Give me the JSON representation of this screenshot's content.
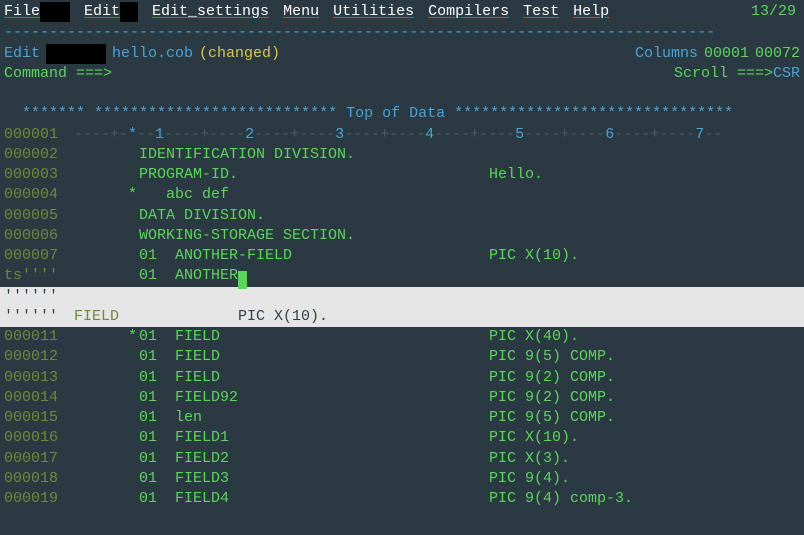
{
  "menu": {
    "items": [
      "File",
      "Edit",
      "Edit_settings",
      "Menu",
      "Utilities",
      "Compilers",
      "Test",
      "Help"
    ],
    "position": "13/29"
  },
  "dash_line": "-------------------------------------------------------------------------------",
  "status": {
    "mode": "Edit",
    "filename": "hello.cob",
    "changed": "(changed)",
    "columns_label": "Columns",
    "col_from": "00001",
    "col_to": "00072"
  },
  "cmdline": {
    "prompt": "Command ===>",
    "scroll_label": "Scroll ===>",
    "scroll_value": "CSR"
  },
  "topdata": {
    "stars_left": "******* *************************** ",
    "label": "Top of Data",
    "stars_right": " *******************************"
  },
  "ruler": {
    "lnnum": "000001",
    "text": "----+-*--1----+----2----+----3----+----4----+----5----+----6----+----7--"
  },
  "lines": [
    {
      "num": "000002",
      "a": "",
      "stmt": "IDENTIFICATION DIVISION.",
      "arg": ""
    },
    {
      "num": "000003",
      "a": "",
      "stmt": "PROGRAM-ID.",
      "arg": "Hello."
    },
    {
      "num": "000004",
      "a": "*",
      "stmt": "   abc def",
      "arg": ""
    },
    {
      "num": "000005",
      "a": "",
      "stmt": "DATA DIVISION.",
      "arg": ""
    },
    {
      "num": "000006",
      "a": "",
      "stmt": "WORKING-STORAGE SECTION.",
      "arg": ""
    },
    {
      "num": "000007",
      "a": "",
      "stmt": "01  ANOTHER-FIELD",
      "arg": "PIC X(10)."
    },
    {
      "num": "ts''''",
      "a": "",
      "stmt": "01  ANOTHER",
      "arg": "",
      "cursor": true
    }
  ],
  "selection": [
    {
      "num": "''''''",
      "a": "",
      "stmt": "",
      "arg": ""
    },
    {
      "num": "''''''",
      "a": "FIELD",
      "stmt": "           PIC X(10).",
      "arg": ""
    }
  ],
  "lines2": [
    {
      "num": "000011",
      "a": "*",
      "stmt": "01  FIELD",
      "arg": "PIC X(40)."
    },
    {
      "num": "000012",
      "a": "",
      "stmt": "01  FIELD",
      "arg": "PIC 9(5) COMP."
    },
    {
      "num": "000013",
      "a": "",
      "stmt": "01  FIELD",
      "arg": "PIC 9(2) COMP."
    },
    {
      "num": "000014",
      "a": "",
      "stmt": "01  FIELD92",
      "arg": "PIC 9(2) COMP."
    },
    {
      "num": "000015",
      "a": "",
      "stmt": "01  len",
      "arg": "PIC 9(5) COMP."
    },
    {
      "num": "000016",
      "a": "",
      "stmt": "01  FIELD1",
      "arg": "PIC X(10)."
    },
    {
      "num": "000017",
      "a": "",
      "stmt": "01  FIELD2",
      "arg": "PIC X(3)."
    },
    {
      "num": "000018",
      "a": "",
      "stmt": "01  FIELD3",
      "arg": "PIC 9(4)."
    },
    {
      "num": "000019",
      "a": "",
      "stmt": "01  FIELD4",
      "arg": "PIC 9(4) comp-3."
    }
  ]
}
